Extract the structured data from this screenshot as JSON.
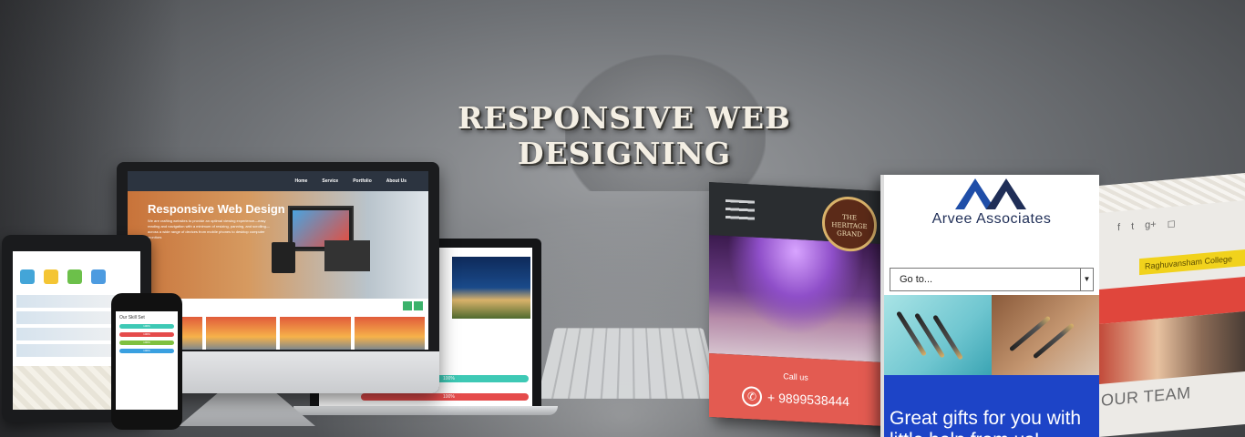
{
  "headline": "RESPONSIVE WEB DESIGNING",
  "imac": {
    "nav": [
      "Home",
      "Service",
      "Portfolio",
      "About Us"
    ],
    "hero_title": "Responsive Web Design",
    "hero_text": "We are crafting websites to provide an optimal viewing experience—easy reading and navigation with a minimum of resizing, panning, and scrolling—across a wide range of devices from mobile phones to desktop computer monitors"
  },
  "laptop": {
    "bars": [
      {
        "label": "100%",
        "color": "#3ec9b5"
      },
      {
        "label": "100%",
        "color": "#e54b4b"
      }
    ]
  },
  "tablet": {
    "icon_colors": [
      "#43a5d8",
      "#f4c534",
      "#6cc04a",
      "#4d9be0"
    ]
  },
  "phone": {
    "title": "Our Skill Set",
    "bars": [
      {
        "label": "100%",
        "color": "#3ec9b5"
      },
      {
        "label": "100%",
        "color": "#e54b4b"
      },
      {
        "label": "100%",
        "color": "#7fc13f"
      },
      {
        "label": "100%",
        "color": "#3aa0e0"
      }
    ]
  },
  "heritage": {
    "logo_line1": "THE",
    "logo_line2": "HERITAGE",
    "logo_line3": "GRAND",
    "call_label": "Call us",
    "phone_number": "+ 9899538444"
  },
  "arvee": {
    "company_name": "Arvee Associates",
    "select_value": "Go to...",
    "tagline": "Great gifts for you with little help from us!"
  },
  "right_phone": {
    "college_name": "Raghuvansham College",
    "section_title": "OUR TEAM"
  }
}
